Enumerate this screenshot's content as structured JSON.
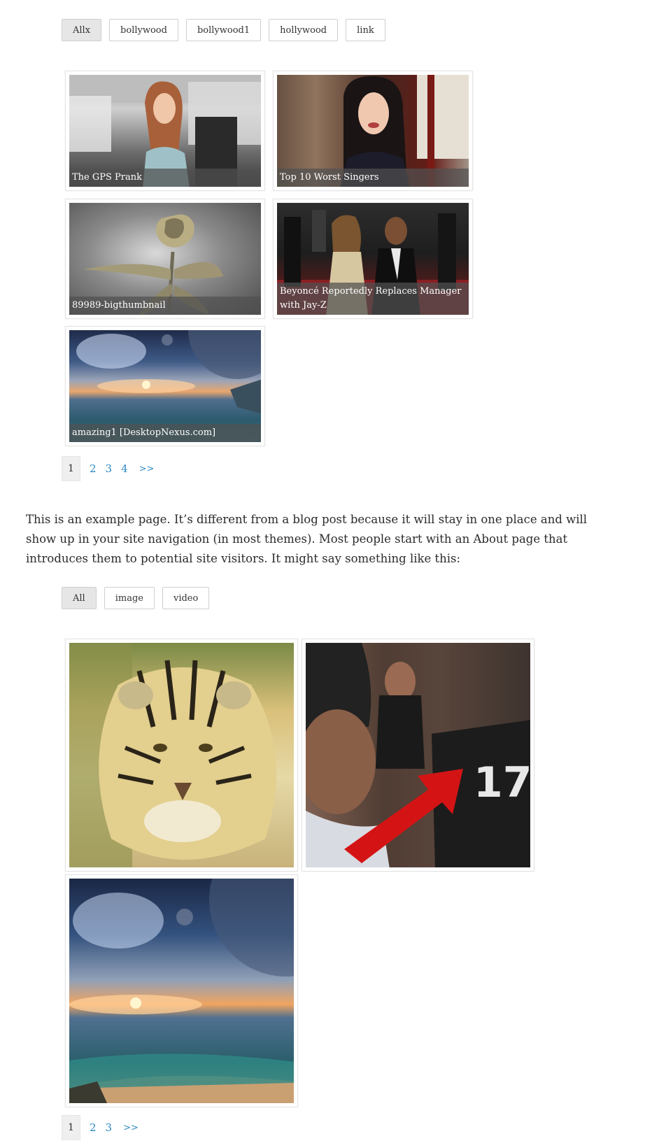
{
  "gallery1": {
    "filters": [
      {
        "label": "Allx",
        "active": true
      },
      {
        "label": "bollywood",
        "active": false
      },
      {
        "label": "bollywood1",
        "active": false
      },
      {
        "label": "hollywood",
        "active": false
      },
      {
        "label": "link",
        "active": false
      }
    ],
    "items": [
      {
        "caption": "The GPS Prank"
      },
      {
        "caption": "Top 10 Worst Singers"
      },
      {
        "caption": "89989-bigthumbnail"
      },
      {
        "caption": "Beyoncé Reportedly Replaces Manager with Jay-Z"
      },
      {
        "caption": "amazing1 [DesktopNexus.com]"
      }
    ],
    "pagination": {
      "current": "1",
      "pages": [
        "2",
        "3",
        "4"
      ],
      "next": ">>"
    }
  },
  "content": {
    "paragraph": "This is an example page. It’s different from a blog post because it will stay in one place and will show up in your site navigation (in most themes). Most people start with an About page that introduces them to potential site visitors. It might say something like this:"
  },
  "gallery2": {
    "filters": [
      {
        "label": "All",
        "active": true
      },
      {
        "label": "image",
        "active": false
      },
      {
        "label": "video",
        "active": false
      }
    ],
    "pagination": {
      "current": "1",
      "pages": [
        "2",
        "3"
      ],
      "next": ">>"
    }
  }
}
